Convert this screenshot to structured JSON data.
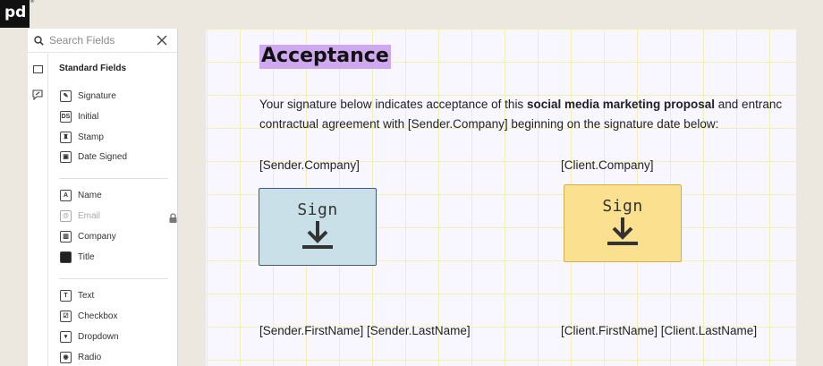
{
  "logo": {
    "text": "pd",
    "mark": "®"
  },
  "search": {
    "placeholder": "Search Fields"
  },
  "fields_panel": {
    "title": "Standard Fields",
    "groups": [
      [
        {
          "label": "Signature",
          "icon": "pen-icon",
          "glyph": "✎"
        },
        {
          "label": "Initial",
          "icon": "initial-icon",
          "glyph": "DS"
        },
        {
          "label": "Stamp",
          "icon": "stamp-icon",
          "glyph": "♜"
        },
        {
          "label": "Date Signed",
          "icon": "calendar-icon",
          "glyph": "▣"
        }
      ],
      [
        {
          "label": "Name",
          "icon": "person-icon",
          "glyph": "A"
        },
        {
          "label": "Email",
          "icon": "at-icon",
          "glyph": "@",
          "disabled": true
        },
        {
          "label": "Company",
          "icon": "building-icon",
          "glyph": "▥"
        },
        {
          "label": "Title",
          "icon": "briefcase-icon",
          "glyph": "■"
        }
      ],
      [
        {
          "label": "Text",
          "icon": "text-icon",
          "glyph": "T"
        },
        {
          "label": "Checkbox",
          "icon": "checkbox-icon",
          "glyph": "☑"
        },
        {
          "label": "Dropdown",
          "icon": "dropdown-icon",
          "glyph": "▾"
        },
        {
          "label": "Radio",
          "icon": "radio-icon",
          "glyph": "◉"
        }
      ]
    ]
  },
  "document": {
    "heading": "Acceptance",
    "para_line1_pre": "Your signature below indicates acceptance of this ",
    "para_line1_bold": "social media marketing proposal",
    "para_line1_post": " and entranc",
    "para_line2": "contractual agreement with [Sender.Company] beginning on the signature date below:",
    "sender_company": "[Sender.Company]",
    "client_company": "[Client.Company]",
    "sign_label": "Sign",
    "sender_name": "[Sender.FirstName] [Sender.LastName]",
    "client_name": "[Client.FirstName] [Client.LastName]"
  },
  "colors": {
    "heading_highlight": "#cfa8f0",
    "sender_sign_bg": "#c9e0e8",
    "client_sign_bg": "#fbe08f",
    "grid_line": "#f0f0b4"
  }
}
